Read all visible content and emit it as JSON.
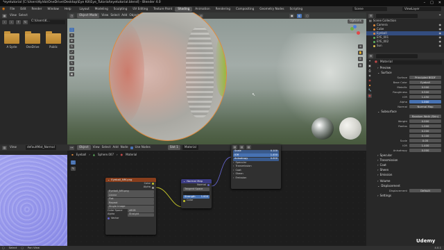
{
  "window_title": "*eyetutorial [C:\\Users\\Kylda\\OneDrive\\Desktop\\Eye Kit\\Eye_Tutorial\\eyetutorial.blend] - Blender 4.0",
  "menu": [
    "File",
    "Edit",
    "Render",
    "Window",
    "Help"
  ],
  "workspace_tabs": [
    "Layout",
    "Modeling",
    "Sculpting",
    "UV Editing",
    "Texture Paint",
    "Shading",
    "Animation",
    "Rendering",
    "Compositing",
    "Geometry Nodes",
    "Scripting"
  ],
  "active_tab": "Shading",
  "scene": {
    "label": "Scene",
    "view_layer": "ViewLayer"
  },
  "file_browser": {
    "view": "View",
    "select": "Select",
    "path": "C:\\Users\\K...",
    "folders": [
      {
        "name": "A Syste"
      },
      {
        "name": "OneDrive"
      },
      {
        "name": "Public"
      }
    ]
  },
  "viewport": {
    "mode": "Object Mode",
    "menus": [
      "View",
      "Select",
      "Add",
      "Object"
    ],
    "orientation": "Global",
    "options": "Options"
  },
  "image_editor": {
    "view": "View",
    "image": "defaultMat_Normal"
  },
  "node_editor": {
    "type": "Object",
    "menus": [
      "View",
      "Select",
      "Add",
      "Node"
    ],
    "use_nodes": "Use Nodes",
    "slot": "Slot 1",
    "material": "Material",
    "breadcrumb": [
      "Eyeball",
      "Sphere.007",
      "Material"
    ]
  },
  "image_node": {
    "title": "Eyeball_NM.png",
    "out_color": "Color",
    "out_alpha": "Alpha",
    "file": "Eyeball_NM.png",
    "rows": [
      "Linear",
      "Flat",
      "Repeat",
      "Single Image"
    ],
    "color_space_label": "Color Space",
    "color_space": "sRGB",
    "alpha_label": "Alpha",
    "alpha": "Straight",
    "vector": "Vector"
  },
  "normal_map_node": {
    "title": "Normal Map",
    "out": "Normal",
    "tangent": "Tangent Space",
    "uv": "",
    "strength_label": "Strength",
    "strength": "1.000",
    "color": "Color"
  },
  "popup": {
    "rows": [
      {
        "l": "Scale",
        "v": "0.100"
      },
      {
        "l": "IOR",
        "v": "1.450"
      },
      {
        "l": "Anisotropy",
        "v": "0.000"
      }
    ],
    "items": [
      "Specular",
      "Transmission",
      "Coat",
      "Sheen",
      "Emission"
    ]
  },
  "outliner": {
    "title": "Scene Collection",
    "items": [
      {
        "name": "Camera",
        "color": "#e08a3c"
      },
      {
        "name": "Cube",
        "color": "#e08a3c"
      },
      {
        "name": "Eyeball",
        "color": "#e08a3c"
      },
      {
        "name": "EYE_001",
        "color": "#5fb25f"
      },
      {
        "name": "EYE_002",
        "color": "#5fb25f"
      },
      {
        "name": "Sun",
        "color": "#e0c050"
      }
    ]
  },
  "properties": {
    "material": "Material",
    "sections": {
      "preview": "Preview",
      "surface": "Surface",
      "subsurface": "Subsurface",
      "specular": "Specular",
      "transmission": "Transmission",
      "coat": "Coat",
      "sheen": "Sheen",
      "emission": "Emission",
      "volume": "Volume",
      "displacement": "Displacement",
      "settings": "Settings"
    },
    "surface_shader": "Principled BSDF",
    "rows": [
      {
        "l": "Base Color",
        "v": "Eyeball"
      },
      {
        "l": "Metallic",
        "v": "0.000"
      },
      {
        "l": "Roughness",
        "v": "0.500"
      },
      {
        "l": "IOR",
        "v": "1.450"
      },
      {
        "l": "Alpha",
        "v": "1.000"
      },
      {
        "l": "Normal",
        "v": "Normal Map"
      }
    ],
    "sub_method": "Random Walk (Skin)",
    "sub_rows": [
      {
        "l": "Weight",
        "v": "0.000"
      },
      {
        "l": "Radius",
        "v": "1.000"
      },
      {
        "l": "",
        "v": "0.200"
      },
      {
        "l": "",
        "v": "0.100"
      },
      {
        "l": "Scale",
        "v": "0.05"
      },
      {
        "l": "IOR",
        "v": "1.400"
      },
      {
        "l": "Anisotropy",
        "v": "0.000"
      }
    ],
    "disp_label": "Displacement",
    "disp_value": "Default"
  },
  "status": {
    "left": "Select",
    "mid": "Pan View",
    "version": "4.0.1"
  },
  "watermark": "Udemy"
}
